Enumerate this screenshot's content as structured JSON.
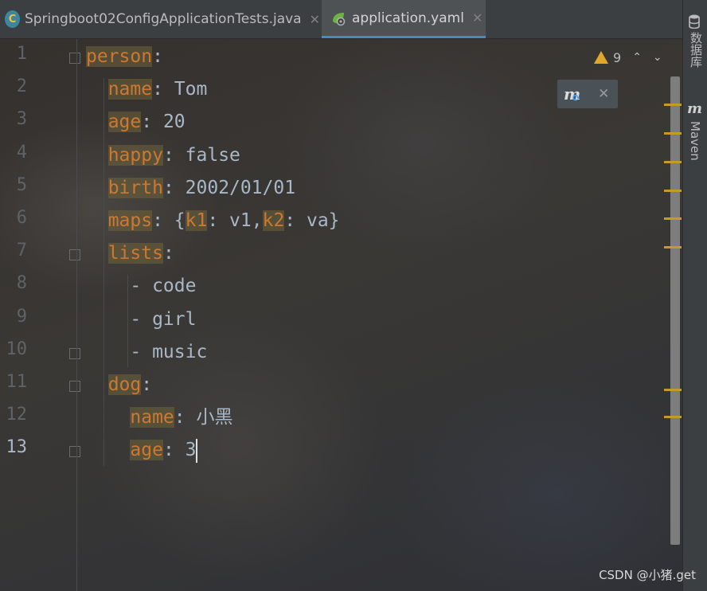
{
  "tabs": [
    {
      "label": "Springboot02ConfigApplicationTests.java",
      "icon": "java-test-class-icon",
      "active": false
    },
    {
      "label": "application.yaml",
      "icon": "spring-config-icon",
      "active": true
    }
  ],
  "tool_windows": {
    "database_label": "数据库",
    "maven_label": "Maven"
  },
  "inspections": {
    "warning_count": "9"
  },
  "maven_popup": {
    "icon": "maven-reload-icon"
  },
  "editor": {
    "current_line": 13,
    "line_numbers": [
      "1",
      "2",
      "3",
      "4",
      "5",
      "6",
      "7",
      "8",
      "9",
      "10",
      "11",
      "12",
      "13"
    ],
    "lines": [
      [
        {
          "t": "person",
          "k": true
        },
        {
          "t": ":",
          "k": false
        }
      ],
      [
        {
          "t": "  ",
          "k": false
        },
        {
          "t": "name",
          "k": true
        },
        {
          "t": ": Tom",
          "k": false
        }
      ],
      [
        {
          "t": "  ",
          "k": false
        },
        {
          "t": "age",
          "k": true
        },
        {
          "t": ": 20",
          "k": false
        }
      ],
      [
        {
          "t": "  ",
          "k": false
        },
        {
          "t": "happy",
          "k": true
        },
        {
          "t": ": false",
          "k": false
        }
      ],
      [
        {
          "t": "  ",
          "k": false
        },
        {
          "t": "birth",
          "k": true
        },
        {
          "t": ": 2002/01/01",
          "k": false
        }
      ],
      [
        {
          "t": "  ",
          "k": false
        },
        {
          "t": "maps",
          "k": true
        },
        {
          "t": ": {",
          "k": false
        },
        {
          "t": "k1",
          "k": true
        },
        {
          "t": ": v1,",
          "k": false
        },
        {
          "t": "k2",
          "k": true
        },
        {
          "t": ": va}",
          "k": false
        }
      ],
      [
        {
          "t": "  ",
          "k": false
        },
        {
          "t": "lists",
          "k": true
        },
        {
          "t": ":",
          "k": false
        }
      ],
      [
        {
          "t": "    - code",
          "k": false
        }
      ],
      [
        {
          "t": "    - girl",
          "k": false
        }
      ],
      [
        {
          "t": "    - music",
          "k": false
        }
      ],
      [
        {
          "t": "  ",
          "k": false
        },
        {
          "t": "dog",
          "k": true
        },
        {
          "t": ":",
          "k": false
        }
      ],
      [
        {
          "t": "    ",
          "k": false
        },
        {
          "t": "name",
          "k": true
        },
        {
          "t": ": 小黑",
          "k": false
        }
      ],
      [
        {
          "t": "    ",
          "k": false
        },
        {
          "t": "age",
          "k": true
        },
        {
          "t": ": 3",
          "k": false
        }
      ]
    ]
  },
  "watermark": "CSDN @小猪.get"
}
